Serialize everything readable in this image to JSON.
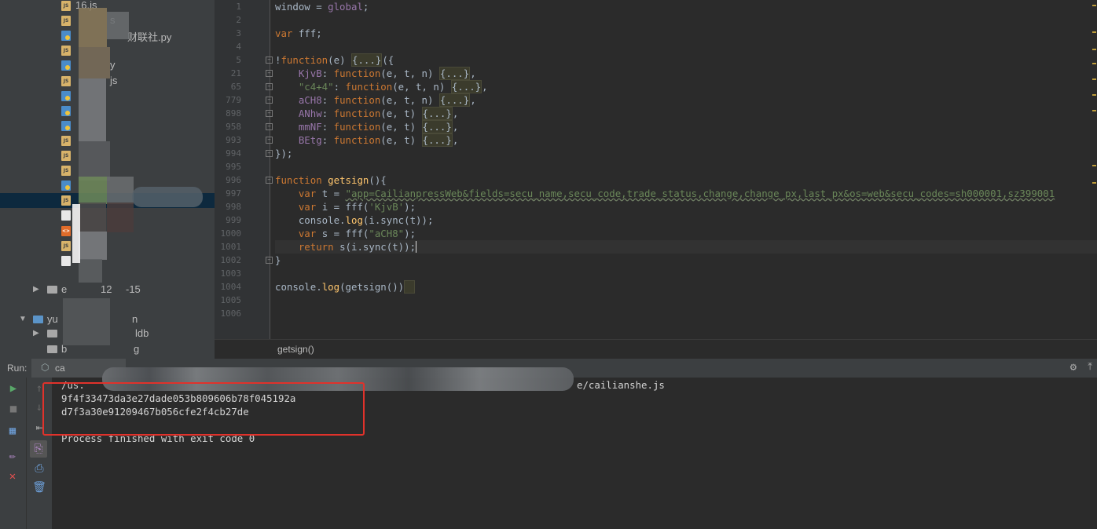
{
  "tree": {
    "rows": [
      {
        "icon": "js",
        "label": "16.js"
      },
      {
        "icon": "js",
        "label": "s"
      },
      {
        "icon": "py",
        "label": "财联社.py"
      },
      {
        "icon": "js",
        "label": ""
      },
      {
        "icon": "py",
        "label": "y"
      },
      {
        "icon": "js",
        "label": "js"
      },
      {
        "icon": "py",
        "label": ""
      },
      {
        "icon": "py",
        "label": ""
      },
      {
        "icon": "py",
        "label": ""
      },
      {
        "icon": "js",
        "label": ""
      },
      {
        "icon": "js",
        "label": ""
      },
      {
        "icon": "js",
        "label": ""
      },
      {
        "icon": "py",
        "label": ""
      },
      {
        "icon": "js",
        "label": ""
      },
      {
        "icon": "plain",
        "label": ""
      },
      {
        "icon": "html",
        "label": ""
      },
      {
        "icon": "js",
        "label": ""
      },
      {
        "icon": "plain",
        "label": ""
      }
    ],
    "folders": [
      {
        "label": "e",
        "suffix": "12",
        "tail": "-15"
      },
      {
        "label": "yu",
        "suffix": "",
        "tail": "n"
      },
      {
        "label": "",
        "suffix": "",
        "tail": "ldb"
      },
      {
        "label": "b",
        "suffix": "",
        "tail": "g"
      }
    ]
  },
  "editor": {
    "line_numbers": [
      "1",
      "2",
      "3",
      "4",
      "5",
      "21",
      "65",
      "779",
      "898",
      "958",
      "993",
      "994",
      "995",
      "996",
      "997",
      "998",
      "999",
      "1000",
      "1001",
      "1002",
      "1003",
      "1004",
      "1005",
      "1006"
    ],
    "code": {
      "l1_a": "window = ",
      "l1_b": "global",
      "l1_c": ";",
      "l3_kw": "var",
      "l3_b": " fff;",
      "l5_a": "!",
      "l5_kw": "function",
      "l5_b": "(e) ",
      "l5_fold": "{...}",
      "l5_c": "({",
      "l6_prop": "KjvB",
      "l6_kw": "function",
      "l6_b": "(e, t, n) ",
      "l6_fold": "{...}",
      "l6_c": ",",
      "l7_str": "\"c4+4\"",
      "l7_kw": "function",
      "l7_b": "(e, t, n) ",
      "l7_fold": "{...}",
      "l7_c": ",",
      "l8_prop": "aCH8",
      "l8_kw": "function",
      "l8_b": "(e, t, n) ",
      "l8_fold": "{...}",
      "l8_c": ",",
      "l9_prop": "ANhw",
      "l9_kw": "function",
      "l9_b": "(e, t) ",
      "l9_fold": "{...}",
      "l9_c": ",",
      "l10_prop": "mmNF",
      "l10_kw": "function",
      "l10_b": "(e, t) ",
      "l10_fold": "{...}",
      "l10_c": ",",
      "l11_prop": "BEtg",
      "l11_kw": "function",
      "l11_b": "(e, t) ",
      "l11_fold": "{...}",
      "l11_c": ",",
      "l12": "});",
      "l14_kw": "function",
      "l14_fn": "getsign",
      "l14_c": "(){",
      "l15_kw": "var",
      "l15_b": " t = ",
      "l15_str": "\"app=CailianpressWeb&fields=secu_name,secu_code,trade_status,change,change_px,last_px&os=web&secu_codes=sh000001,sz399001",
      "l16_kw": "var",
      "l16_b": " i = fff(",
      "l16_str": "'KjvB'",
      "l16_c": ");",
      "l17_a": "console.",
      "l17_fn": "log",
      "l17_b": "(i.sync(t));",
      "l18_kw": "var",
      "l18_b": " s = fff(",
      "l18_str": "\"aCH8\"",
      "l18_c": ");",
      "l19_kw": "return",
      "l19_b": " s(i.sync(t));",
      "l20": "}",
      "l22_a": "console.",
      "l22_fn": "log",
      "l22_b": "(getsign())"
    }
  },
  "breadcrumb": "getsign()",
  "run": {
    "label": "Run:",
    "tab": "ca",
    "lines": [
      "/us.",
      "e/cailianshe.js",
      "9f4f33473da3e27dade053b809606b78f045192a",
      "d7f3a30e91209467b056cfe2f4cb27de",
      "Process finished with exit code 0"
    ]
  },
  "colors": {
    "keyword": "#cc7832",
    "function": "#ffc66d",
    "string": "#6a8759",
    "property": "#9876aa",
    "highlight": "#e0322b"
  }
}
